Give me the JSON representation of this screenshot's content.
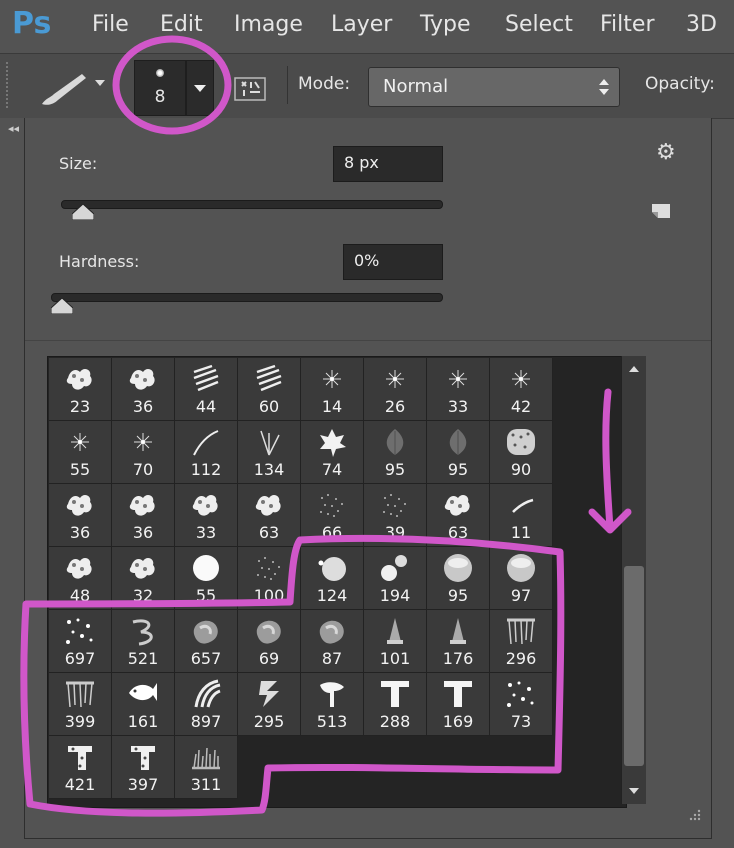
{
  "app": {
    "logo": "Ps",
    "accent": "#4a9ad4"
  },
  "menu": [
    "File",
    "Edit",
    "Image",
    "Layer",
    "Type",
    "Select",
    "Filter",
    "3D"
  ],
  "options_bar": {
    "brush_size": "8",
    "mode_label": "Mode:",
    "mode_value": "Normal",
    "opacity_label": "Opacity:"
  },
  "picker": {
    "size_label": "Size:",
    "size_value": "8 px",
    "size_slider_fraction": 0.03,
    "hardness_label": "Hardness:",
    "hardness_value": "0%",
    "hardness_slider_fraction": 0.0
  },
  "brushes": [
    {
      "size": "23",
      "shape": "splat"
    },
    {
      "size": "36",
      "shape": "splat"
    },
    {
      "size": "44",
      "shape": "hatch"
    },
    {
      "size": "60",
      "shape": "hatch"
    },
    {
      "size": "14",
      "shape": "star"
    },
    {
      "size": "26",
      "shape": "star"
    },
    {
      "size": "33",
      "shape": "star"
    },
    {
      "size": "42",
      "shape": "star"
    },
    {
      "size": "55",
      "shape": "star"
    },
    {
      "size": "70",
      "shape": "star"
    },
    {
      "size": "112",
      "shape": "grass1"
    },
    {
      "size": "134",
      "shape": "grass2"
    },
    {
      "size": "74",
      "shape": "leaf"
    },
    {
      "size": "95",
      "shape": "leafdark"
    },
    {
      "size": "95",
      "shape": "leafdark"
    },
    {
      "size": "90",
      "shape": "texture"
    },
    {
      "size": "36",
      "shape": "splat"
    },
    {
      "size": "36",
      "shape": "splat"
    },
    {
      "size": "33",
      "shape": "splat"
    },
    {
      "size": "63",
      "shape": "splat"
    },
    {
      "size": "66",
      "shape": "speckle"
    },
    {
      "size": "39",
      "shape": "speckle"
    },
    {
      "size": "63",
      "shape": "splat"
    },
    {
      "size": "11",
      "shape": "streak"
    },
    {
      "size": "48",
      "shape": "splat"
    },
    {
      "size": "32",
      "shape": "splat"
    },
    {
      "size": "55",
      "shape": "round"
    },
    {
      "size": "100",
      "shape": "speckle"
    },
    {
      "size": "124",
      "shape": "soft"
    },
    {
      "size": "194",
      "shape": "soft2"
    },
    {
      "size": "95",
      "shape": "sphere"
    },
    {
      "size": "97",
      "shape": "sphere"
    },
    {
      "size": "697",
      "shape": "dots"
    },
    {
      "size": "521",
      "shape": "curl"
    },
    {
      "size": "657",
      "shape": "blob"
    },
    {
      "size": "69",
      "shape": "blob"
    },
    {
      "size": "87",
      "shape": "blob"
    },
    {
      "size": "101",
      "shape": "cone"
    },
    {
      "size": "176",
      "shape": "cone"
    },
    {
      "size": "296",
      "shape": "fringe"
    },
    {
      "size": "399",
      "shape": "fringe"
    },
    {
      "size": "161",
      "shape": "fish"
    },
    {
      "size": "897",
      "shape": "sweep"
    },
    {
      "size": "295",
      "shape": "zig"
    },
    {
      "size": "513",
      "shape": "tree"
    },
    {
      "size": "288",
      "shape": "tee"
    },
    {
      "size": "169",
      "shape": "tee"
    },
    {
      "size": "73",
      "shape": "dots"
    },
    {
      "size": "421",
      "shape": "rough"
    },
    {
      "size": "397",
      "shape": "rough"
    },
    {
      "size": "311",
      "shape": "grassrow"
    }
  ],
  "annotation": {
    "color": "#d057c9"
  }
}
